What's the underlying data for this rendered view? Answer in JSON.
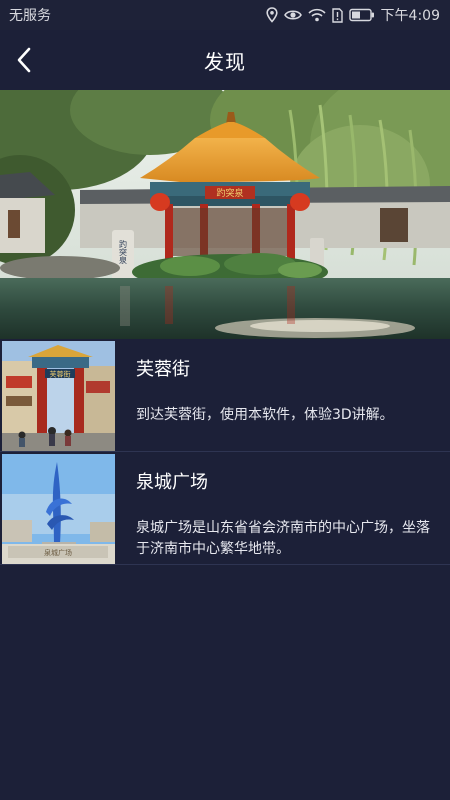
{
  "status_bar": {
    "carrier": "无服务",
    "time": "下午4:09",
    "icons": [
      "location-icon",
      "eye-icon",
      "wifi-icon",
      "sim-alert-icon",
      "battery-icon"
    ]
  },
  "nav": {
    "title": "发现",
    "back_icon": "chevron-left-icon"
  },
  "hero": {
    "sign_text": "趵突泉",
    "plaque_text": "趵突泉"
  },
  "items": [
    {
      "title": "芙蓉街",
      "desc": "到达芙蓉街，使用本软件，体验3D讲解。",
      "thumb_sign": "芙蓉街"
    },
    {
      "title": "泉城广场",
      "desc": "泉城广场是山东省省会济南市的中心广场，坐落于济南市中心繁华地带。",
      "thumb_sign": "泉城广场"
    }
  ],
  "colors": {
    "background": "#1c2038",
    "divider": "#2e3452",
    "text": "#ffffff"
  }
}
